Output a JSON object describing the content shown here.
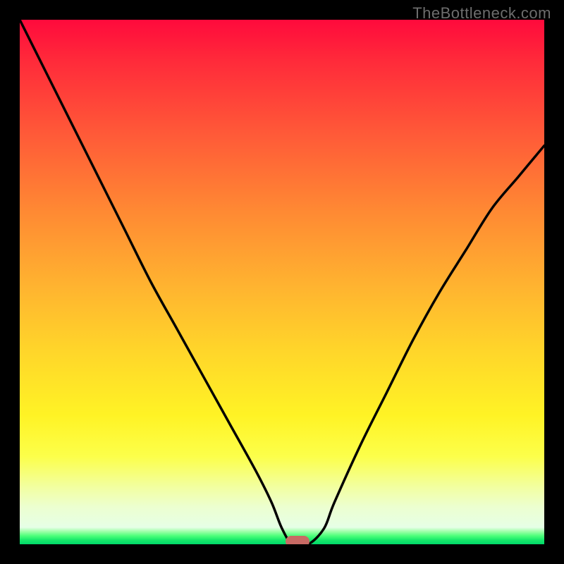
{
  "watermark": "TheBottleneck.com",
  "colors": {
    "frame": "#000000",
    "curve": "#000000",
    "marker": "#c86a64",
    "gradient_top": "#ff0a3c",
    "gradient_mid": "#ffd52a",
    "gradient_bottom": "#00d86a"
  },
  "chart_data": {
    "type": "line",
    "title": "",
    "xlabel": "",
    "ylabel": "",
    "xlim": [
      0,
      100
    ],
    "ylim": [
      0,
      100
    ],
    "grid": false,
    "series": [
      {
        "name": "bottleneck-curve",
        "x": [
          0,
          5,
          10,
          15,
          20,
          25,
          30,
          35,
          40,
          45,
          48,
          50,
          52,
          55,
          58,
          60,
          65,
          70,
          75,
          80,
          85,
          90,
          95,
          100
        ],
        "values": [
          100,
          90,
          80,
          70,
          60,
          50,
          41,
          32,
          23,
          14,
          8,
          3,
          0,
          0,
          3,
          8,
          19,
          29,
          39,
          48,
          56,
          64,
          70,
          76
        ]
      }
    ],
    "marker": {
      "x": 53,
      "y": 0
    },
    "annotations": []
  }
}
